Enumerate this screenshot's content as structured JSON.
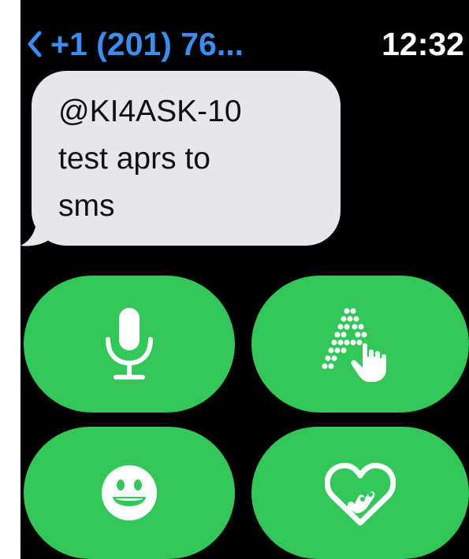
{
  "header": {
    "back_label": "+1 (201) 76...",
    "time": "12:32"
  },
  "message": {
    "text": "@KI4ASK-10\ntest aprs to\nsms"
  },
  "actions": [
    {
      "icon": "microphone-icon"
    },
    {
      "icon": "scribble-icon"
    },
    {
      "icon": "emoji-icon"
    },
    {
      "icon": "digital-touch-icon"
    }
  ],
  "colors": {
    "background": "#000000",
    "accent_blue": "#3b8df2",
    "bubble": "#e6e6eb",
    "action_green": "#33c75a"
  }
}
